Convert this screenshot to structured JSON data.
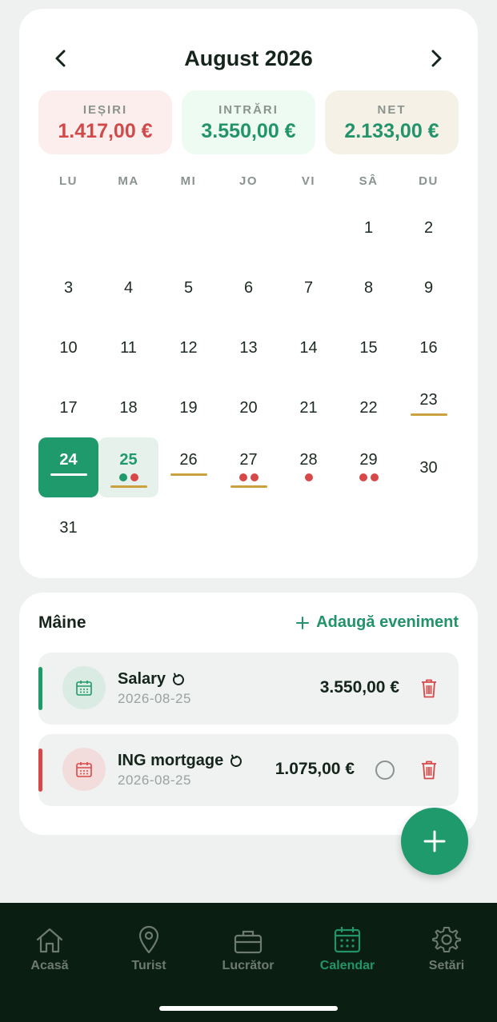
{
  "calendar": {
    "month_title": "August 2026",
    "summary": {
      "out_label": "IEȘIRI",
      "out_amount": "1.417,00 €",
      "in_label": "INTRĂRI",
      "in_amount": "3.550,00 €",
      "net_label": "NET",
      "net_amount": "2.133,00 €"
    },
    "weekdays": [
      "LU",
      "MA",
      "MI",
      "JO",
      "VI",
      "SÂ",
      "DU"
    ],
    "days": [
      {
        "n": "1",
        "col": 5,
        "row": 0
      },
      {
        "n": "2",
        "col": 6,
        "row": 0
      },
      {
        "n": "3",
        "col": 0,
        "row": 1
      },
      {
        "n": "4",
        "col": 1,
        "row": 1
      },
      {
        "n": "5",
        "col": 2,
        "row": 1
      },
      {
        "n": "6",
        "col": 3,
        "row": 1
      },
      {
        "n": "7",
        "col": 4,
        "row": 1
      },
      {
        "n": "8",
        "col": 5,
        "row": 1
      },
      {
        "n": "9",
        "col": 6,
        "row": 1
      },
      {
        "n": "10",
        "col": 0,
        "row": 2
      },
      {
        "n": "11",
        "col": 1,
        "row": 2
      },
      {
        "n": "12",
        "col": 2,
        "row": 2
      },
      {
        "n": "13",
        "col": 3,
        "row": 2
      },
      {
        "n": "14",
        "col": 4,
        "row": 2
      },
      {
        "n": "15",
        "col": 5,
        "row": 2
      },
      {
        "n": "16",
        "col": 6,
        "row": 2
      },
      {
        "n": "17",
        "col": 0,
        "row": 3
      },
      {
        "n": "18",
        "col": 1,
        "row": 3
      },
      {
        "n": "19",
        "col": 2,
        "row": 3
      },
      {
        "n": "20",
        "col": 3,
        "row": 3
      },
      {
        "n": "21",
        "col": 4,
        "row": 3
      },
      {
        "n": "22",
        "col": 5,
        "row": 3
      },
      {
        "n": "23",
        "col": 6,
        "row": 3,
        "uline": true
      },
      {
        "n": "24",
        "col": 0,
        "row": 4,
        "today": true,
        "uline": true
      },
      {
        "n": "25",
        "col": 1,
        "row": 4,
        "selected": true,
        "dots": [
          "green",
          "red"
        ],
        "uline": true
      },
      {
        "n": "26",
        "col": 2,
        "row": 4,
        "uline": true
      },
      {
        "n": "27",
        "col": 3,
        "row": 4,
        "dots": [
          "red",
          "red"
        ],
        "uline": true
      },
      {
        "n": "28",
        "col": 4,
        "row": 4,
        "dots": [
          "red"
        ]
      },
      {
        "n": "29",
        "col": 5,
        "row": 4,
        "dots": [
          "red",
          "red"
        ]
      },
      {
        "n": "30",
        "col": 6,
        "row": 4
      },
      {
        "n": "31",
        "col": 0,
        "row": 5
      }
    ]
  },
  "events": {
    "title": "Mâine",
    "add_label": "Adaugă eveniment",
    "items": [
      {
        "name": "Salary",
        "date": "2026-08-25",
        "amount": "3.550,00 €",
        "type": "income",
        "color": "#1f9a6d"
      },
      {
        "name": "ING mortgage",
        "date": "2026-08-25",
        "amount": "1.075,00 €",
        "type": "expense",
        "color": "#d94848"
      }
    ]
  },
  "tabs": [
    {
      "label": "Acasă",
      "icon": "home-icon"
    },
    {
      "label": "Turist",
      "icon": "map-pin-icon"
    },
    {
      "label": "Lucrător",
      "icon": "briefcase-icon"
    },
    {
      "label": "Calendar",
      "icon": "calendar-icon",
      "active": true
    },
    {
      "label": "Setări",
      "icon": "gear-icon"
    }
  ],
  "colors": {
    "accent": "#1f9a6d",
    "expense": "#d94848",
    "highlight": "#c9a23e",
    "tabbar": "#0b1e12"
  }
}
